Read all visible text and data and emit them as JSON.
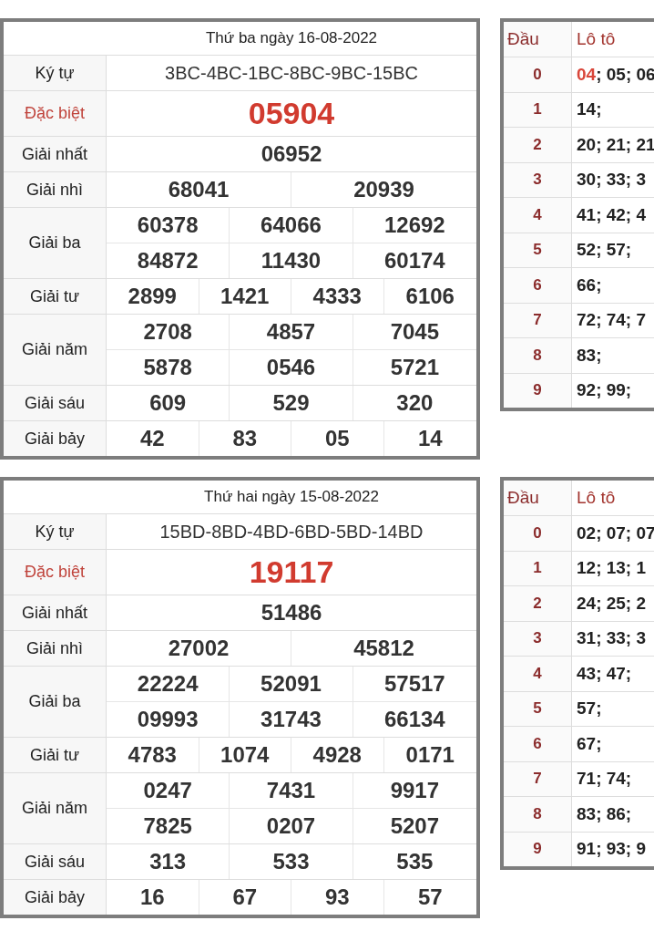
{
  "results": [
    {
      "title": "Thứ ba ngày 16-08-2022",
      "rows": [
        {
          "kind": "code",
          "label": "Ký tự",
          "lines": [
            [
              "3BC-4BC-1BC-8BC-9BC-15BC"
            ]
          ]
        },
        {
          "kind": "special",
          "label": "Đặc biệt",
          "lines": [
            [
              "05904"
            ]
          ]
        },
        {
          "kind": "prize",
          "label": "Giải nhất",
          "lines": [
            [
              "06952"
            ]
          ]
        },
        {
          "kind": "prize",
          "label": "Giải nhì",
          "lines": [
            [
              "68041",
              "20939"
            ]
          ]
        },
        {
          "kind": "prize",
          "label": "Giải ba",
          "lines": [
            [
              "60378",
              "64066",
              "12692"
            ],
            [
              "84872",
              "11430",
              "60174"
            ]
          ]
        },
        {
          "kind": "prize",
          "label": "Giải tư",
          "lines": [
            [
              "2899",
              "1421",
              "4333",
              "6106"
            ]
          ]
        },
        {
          "kind": "prize",
          "label": "Giải năm",
          "lines": [
            [
              "2708",
              "4857",
              "7045"
            ],
            [
              "5878",
              "0546",
              "5721"
            ]
          ]
        },
        {
          "kind": "prize",
          "label": "Giải sáu",
          "lines": [
            [
              "609",
              "529",
              "320"
            ]
          ]
        },
        {
          "kind": "prize",
          "label": "Giải bảy",
          "lines": [
            [
              "42",
              "83",
              "05",
              "14"
            ]
          ]
        }
      ],
      "loto": {
        "headers": [
          "Đầu",
          "Lô tô"
        ],
        "rows": [
          {
            "head": "0",
            "parts": [
              {
                "text": "04",
                "highlighted": true
              },
              {
                "text": "; 05; 06",
                "highlighted": false
              }
            ]
          },
          {
            "head": "1",
            "parts": [
              {
                "text": "14;",
                "highlighted": false
              }
            ]
          },
          {
            "head": "2",
            "parts": [
              {
                "text": "20; 21; 21",
                "highlighted": false
              }
            ]
          },
          {
            "head": "3",
            "parts": [
              {
                "text": "30; 33; 3",
                "highlighted": false
              }
            ]
          },
          {
            "head": "4",
            "parts": [
              {
                "text": "41; 42; 4",
                "highlighted": false
              }
            ]
          },
          {
            "head": "5",
            "parts": [
              {
                "text": "52; 57;",
                "highlighted": false
              }
            ]
          },
          {
            "head": "6",
            "parts": [
              {
                "text": "66;",
                "highlighted": false
              }
            ]
          },
          {
            "head": "7",
            "parts": [
              {
                "text": "72; 74; 7",
                "highlighted": false
              }
            ]
          },
          {
            "head": "8",
            "parts": [
              {
                "text": "83;",
                "highlighted": false
              }
            ]
          },
          {
            "head": "9",
            "parts": [
              {
                "text": "92; 99;",
                "highlighted": false
              }
            ]
          }
        ]
      }
    },
    {
      "title": "Thứ hai ngày 15-08-2022",
      "rows": [
        {
          "kind": "code",
          "label": "Ký tự",
          "lines": [
            [
              "15BD-8BD-4BD-6BD-5BD-14BD"
            ]
          ]
        },
        {
          "kind": "special",
          "label": "Đặc biệt",
          "lines": [
            [
              "19117"
            ]
          ]
        },
        {
          "kind": "prize",
          "label": "Giải nhất",
          "lines": [
            [
              "51486"
            ]
          ]
        },
        {
          "kind": "prize",
          "label": "Giải nhì",
          "lines": [
            [
              "27002",
              "45812"
            ]
          ]
        },
        {
          "kind": "prize",
          "label": "Giải ba",
          "lines": [
            [
              "22224",
              "52091",
              "57517"
            ],
            [
              "09993",
              "31743",
              "66134"
            ]
          ]
        },
        {
          "kind": "prize",
          "label": "Giải tư",
          "lines": [
            [
              "4783",
              "1074",
              "4928",
              "0171"
            ]
          ]
        },
        {
          "kind": "prize",
          "label": "Giải năm",
          "lines": [
            [
              "0247",
              "7431",
              "9917"
            ],
            [
              "7825",
              "0207",
              "5207"
            ]
          ]
        },
        {
          "kind": "prize",
          "label": "Giải sáu",
          "lines": [
            [
              "313",
              "533",
              "535"
            ]
          ]
        },
        {
          "kind": "prize",
          "label": "Giải bảy",
          "lines": [
            [
              "16",
              "67",
              "93",
              "57"
            ]
          ]
        }
      ],
      "loto": {
        "headers": [
          "Đầu",
          "Lô tô"
        ],
        "rows": [
          {
            "head": "0",
            "parts": [
              {
                "text": "02; 07; 07",
                "highlighted": false
              }
            ]
          },
          {
            "head": "1",
            "parts": [
              {
                "text": "12; 13; 1",
                "highlighted": false
              }
            ]
          },
          {
            "head": "2",
            "parts": [
              {
                "text": "24; 25; 2",
                "highlighted": false
              }
            ]
          },
          {
            "head": "3",
            "parts": [
              {
                "text": "31; 33; 3",
                "highlighted": false
              }
            ]
          },
          {
            "head": "4",
            "parts": [
              {
                "text": "43; 47;",
                "highlighted": false
              }
            ]
          },
          {
            "head": "5",
            "parts": [
              {
                "text": "57;",
                "highlighted": false
              }
            ]
          },
          {
            "head": "6",
            "parts": [
              {
                "text": "67;",
                "highlighted": false
              }
            ]
          },
          {
            "head": "7",
            "parts": [
              {
                "text": "71; 74;",
                "highlighted": false
              }
            ]
          },
          {
            "head": "8",
            "parts": [
              {
                "text": "83; 86;",
                "highlighted": false
              }
            ]
          },
          {
            "head": "9",
            "parts": [
              {
                "text": "91; 93; 9",
                "highlighted": false
              }
            ]
          }
        ]
      }
    }
  ]
}
